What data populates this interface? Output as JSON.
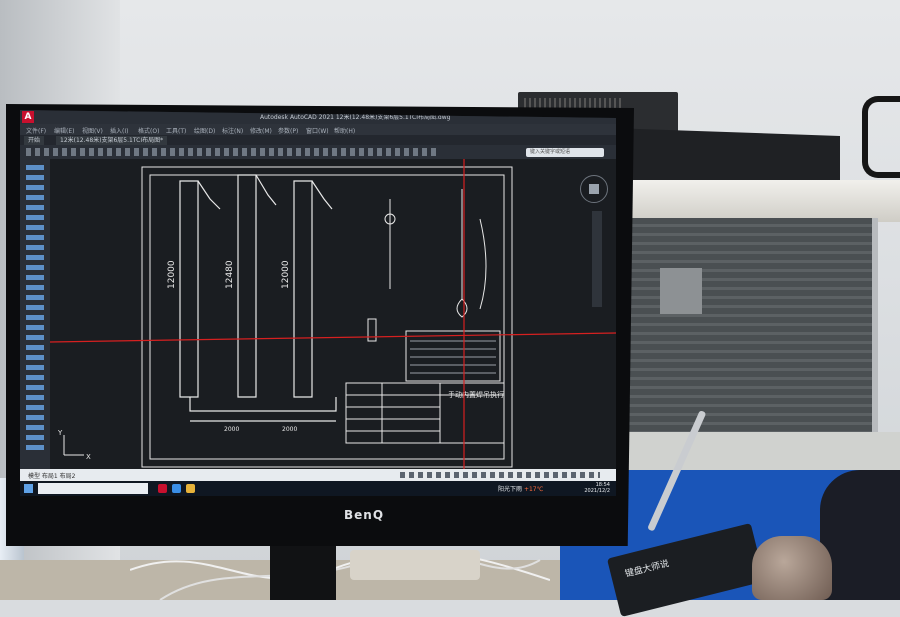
{
  "scene": {
    "monitor_brand": "BenQ",
    "keyboard_label": "键盘大师说",
    "wall_color": "#dcdfe2",
    "blue_panel_color": "#1a55b8"
  },
  "app": {
    "logo_letter": "A",
    "title": "Autodesk AutoCAD 2021   12米(12.48米)支架6层5.1TCI布局图.dwg",
    "menu_items": [
      "文件(F)",
      "编辑(E)",
      "视图(V)",
      "插入(I)",
      "格式(O)",
      "工具(T)",
      "绘图(D)",
      "标注(N)",
      "修改(M)",
      "参数(P)",
      "窗口(W)",
      "帮助(H)"
    ],
    "tabs": [
      "开始",
      "12米(12.48米)支架6层5.1TCI布局图*"
    ],
    "search_placeholder": "键入关键字或短语",
    "layout_tabs": "模型   布局1   布局2"
  },
  "drawing": {
    "column_heights": [
      "12000",
      "12480",
      "12000"
    ],
    "dim_bottom": [
      "2000",
      "2000"
    ],
    "table_title": "手动内置焊吊执行",
    "axis_label_x": "X",
    "axis_label_y": "Y",
    "crosshair_color": "#d62020",
    "line_color": "#e8e8e8"
  },
  "taskbar": {
    "weather": "阳光下雨",
    "temperature": "+17℃",
    "time": "18:54",
    "date": "2021/12/2"
  }
}
